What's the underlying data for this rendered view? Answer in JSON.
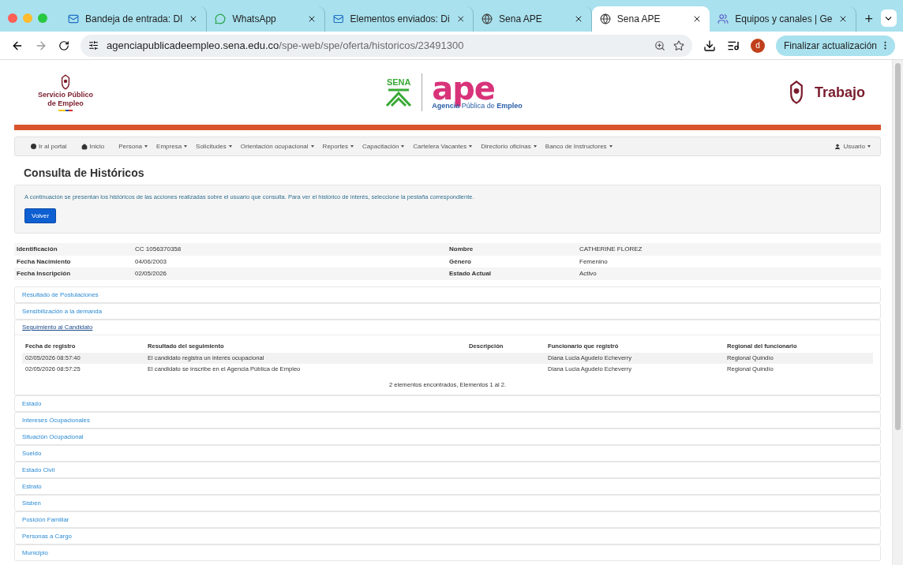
{
  "browser": {
    "tabs": [
      {
        "kind": "mail",
        "title": "Bandeja de entrada: DI",
        "selected": false
      },
      {
        "kind": "chat",
        "title": "WhatsApp",
        "selected": false
      },
      {
        "kind": "mail",
        "title": "Elementos enviados: Di",
        "selected": false
      },
      {
        "kind": "web",
        "title": "Sena APE",
        "selected": false
      },
      {
        "kind": "web",
        "title": "Sena APE",
        "selected": true
      },
      {
        "kind": "team",
        "title": "Equipos y canales | Ge",
        "selected": false
      }
    ],
    "new_tab": "+",
    "url_host": "agenciapublicadeempleo.sena.edu.co",
    "url_path": "/spe-web/spe/oferta/historicos/23491300",
    "profile": "d",
    "update_button": "Finalizar actualización"
  },
  "header": {
    "left_logo": [
      "Servicio Público",
      "de Empleo"
    ],
    "sena": "SENA",
    "ape": "ape",
    "ape_subtitle_prefix": "Agencia ",
    "ape_subtitle_mid": "Pública de ",
    "ape_subtitle_suffix": "Empleo",
    "right_logo": "Trabajo"
  },
  "nav": {
    "items": [
      {
        "kind": "portal",
        "label": "Ir al portal"
      },
      {
        "kind": "home",
        "label": "Inicio"
      },
      {
        "kind": "menu",
        "label": "Persona"
      },
      {
        "kind": "menu",
        "label": "Empresa"
      },
      {
        "kind": "menu",
        "label": "Solicitudes"
      },
      {
        "kind": "menu",
        "label": "Orientación ocupacional"
      },
      {
        "kind": "menu",
        "label": "Reportes"
      },
      {
        "kind": "menu",
        "label": "Capacitación"
      },
      {
        "kind": "menu",
        "label": "Cartelera Vacantes"
      },
      {
        "kind": "menu",
        "label": "Directorio oficinas"
      },
      {
        "kind": "menu",
        "label": "Banco de Instructores"
      }
    ],
    "user": "Usuario"
  },
  "title": "Consulta de Históricos",
  "notice": "A continuación se presentan los históricos de las acciones realizadas sobre el usuario que consulta. Para ver el histórico de interés, seleccione la pestaña correspondiente.",
  "back_button": "Volver",
  "person": [
    [
      {
        "label": "Identificación",
        "value": "CC 1056370358"
      },
      {
        "label": "Nombre",
        "value": "CATHERINE FLOREZ"
      }
    ],
    [
      {
        "label": "Fecha Nacimiento",
        "value": "04/06/2003"
      },
      {
        "label": "Género",
        "value": "Femenino"
      }
    ],
    [
      {
        "label": "Fecha Inscripción",
        "value": "02/05/2026"
      },
      {
        "label": "Estado Actual",
        "value": "Activo"
      }
    ]
  ],
  "sections": [
    {
      "label": "Resultado de Postulaciones",
      "expanded": false
    },
    {
      "label": "Sensibilización a la demanda",
      "expanded": false
    },
    {
      "label": "Seguimiento al Candidato",
      "expanded": true,
      "columns": [
        "Fecha de registro",
        "Resultado del seguimiento",
        "Descripción",
        "Funcionario que registró",
        "Regional del funcionario"
      ],
      "rows": [
        [
          "02/05/2026 08:57:40",
          "El candidato registra un interés ocupacional",
          "",
          "Diana Lucia Agudelo Echeverry",
          "Regional Quindío"
        ],
        [
          "02/05/2026 08:57:25",
          "El candidato se inscribe en el Agencia Pública de Empleo",
          "",
          "Diana Lucia Agudelo Echeverry",
          "Regional Quindío"
        ]
      ],
      "footer": "2 elementos encontrados, Elementos 1 al 2."
    },
    {
      "label": "Estado",
      "expanded": false
    },
    {
      "label": "Intereses Ocupacionales",
      "expanded": false
    },
    {
      "label": "Situación Ocupacional",
      "expanded": false
    },
    {
      "label": "Sueldo",
      "expanded": false
    },
    {
      "label": "Estado Civil",
      "expanded": false
    },
    {
      "label": "Estrato",
      "expanded": false
    },
    {
      "label": "Sisben",
      "expanded": false
    },
    {
      "label": "Posición Familiar",
      "expanded": false
    },
    {
      "label": "Personas a Cargo",
      "expanded": false
    },
    {
      "label": "Municipio",
      "expanded": false
    }
  ]
}
